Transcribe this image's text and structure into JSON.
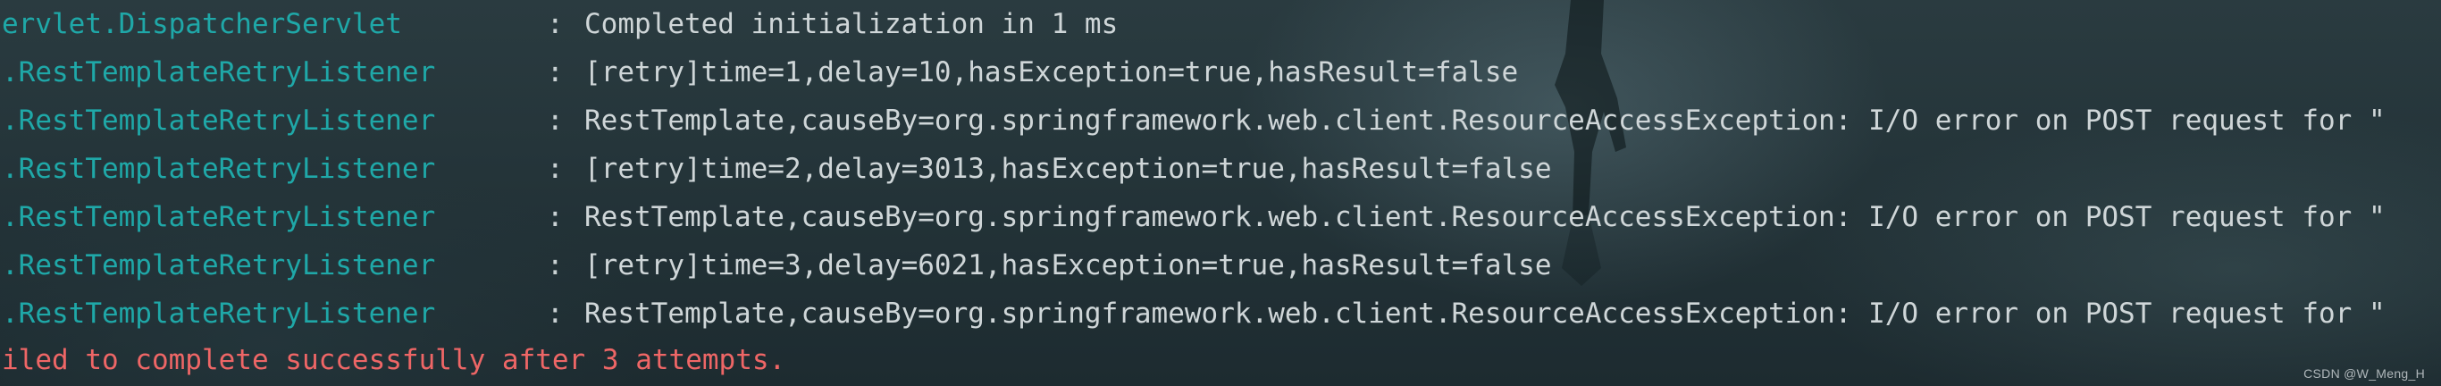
{
  "console": {
    "lines": [
      {
        "logger": "ervlet.DispatcherServlet",
        "separator": ":",
        "message": "Completed initialization in 1 ms"
      },
      {
        "logger": ".RestTemplateRetryListener",
        "separator": ":",
        "message": "[retry]time=1,delay=10,hasException=true,hasResult=false"
      },
      {
        "logger": ".RestTemplateRetryListener",
        "separator": ":",
        "message": "RestTemplate,causeBy=org.springframework.web.client.ResourceAccessException: I/O error on POST request for \""
      },
      {
        "logger": ".RestTemplateRetryListener",
        "separator": ":",
        "message": "[retry]time=2,delay=3013,hasException=true,hasResult=false"
      },
      {
        "logger": ".RestTemplateRetryListener",
        "separator": ":",
        "message": "RestTemplate,causeBy=org.springframework.web.client.ResourceAccessException: I/O error on POST request for \""
      },
      {
        "logger": ".RestTemplateRetryListener",
        "separator": ":",
        "message": "[retry]time=3,delay=6021,hasException=true,hasResult=false"
      },
      {
        "logger": ".RestTemplateRetryListener",
        "separator": ":",
        "message": "RestTemplate,causeBy=org.springframework.web.client.ResourceAccessException: I/O error on POST request for \""
      }
    ],
    "error_line": "iled to complete successfully after 3 attempts.",
    "watermark": "CSDN @W_Meng_H",
    "colors": {
      "logger": "#1fa8a8",
      "message": "#cfd6d8",
      "error": "#ee6666",
      "background": "#1f2e33"
    }
  }
}
